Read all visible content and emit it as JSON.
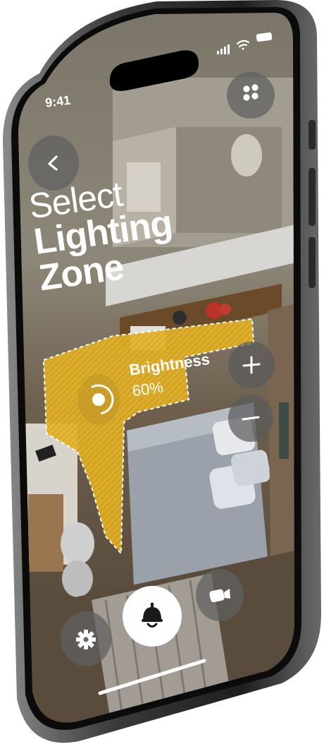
{
  "status_bar": {
    "time": "9:41"
  },
  "header": {
    "title_line1": "Select",
    "title_line2": "Lighting",
    "title_line3": "Zone"
  },
  "zone": {
    "brightness_label": "Brightness",
    "brightness_value": "60%",
    "brightness_level": 0.6,
    "highlight_color": "#E5B52A"
  },
  "icons": {
    "back": "chevron-left-icon",
    "menu": "grid-dots-icon",
    "increase": "plus-icon",
    "decrease": "minus-icon",
    "settings": "gear-icon",
    "main": "ceiling-lamp-icon",
    "camera": "video-camera-icon"
  }
}
